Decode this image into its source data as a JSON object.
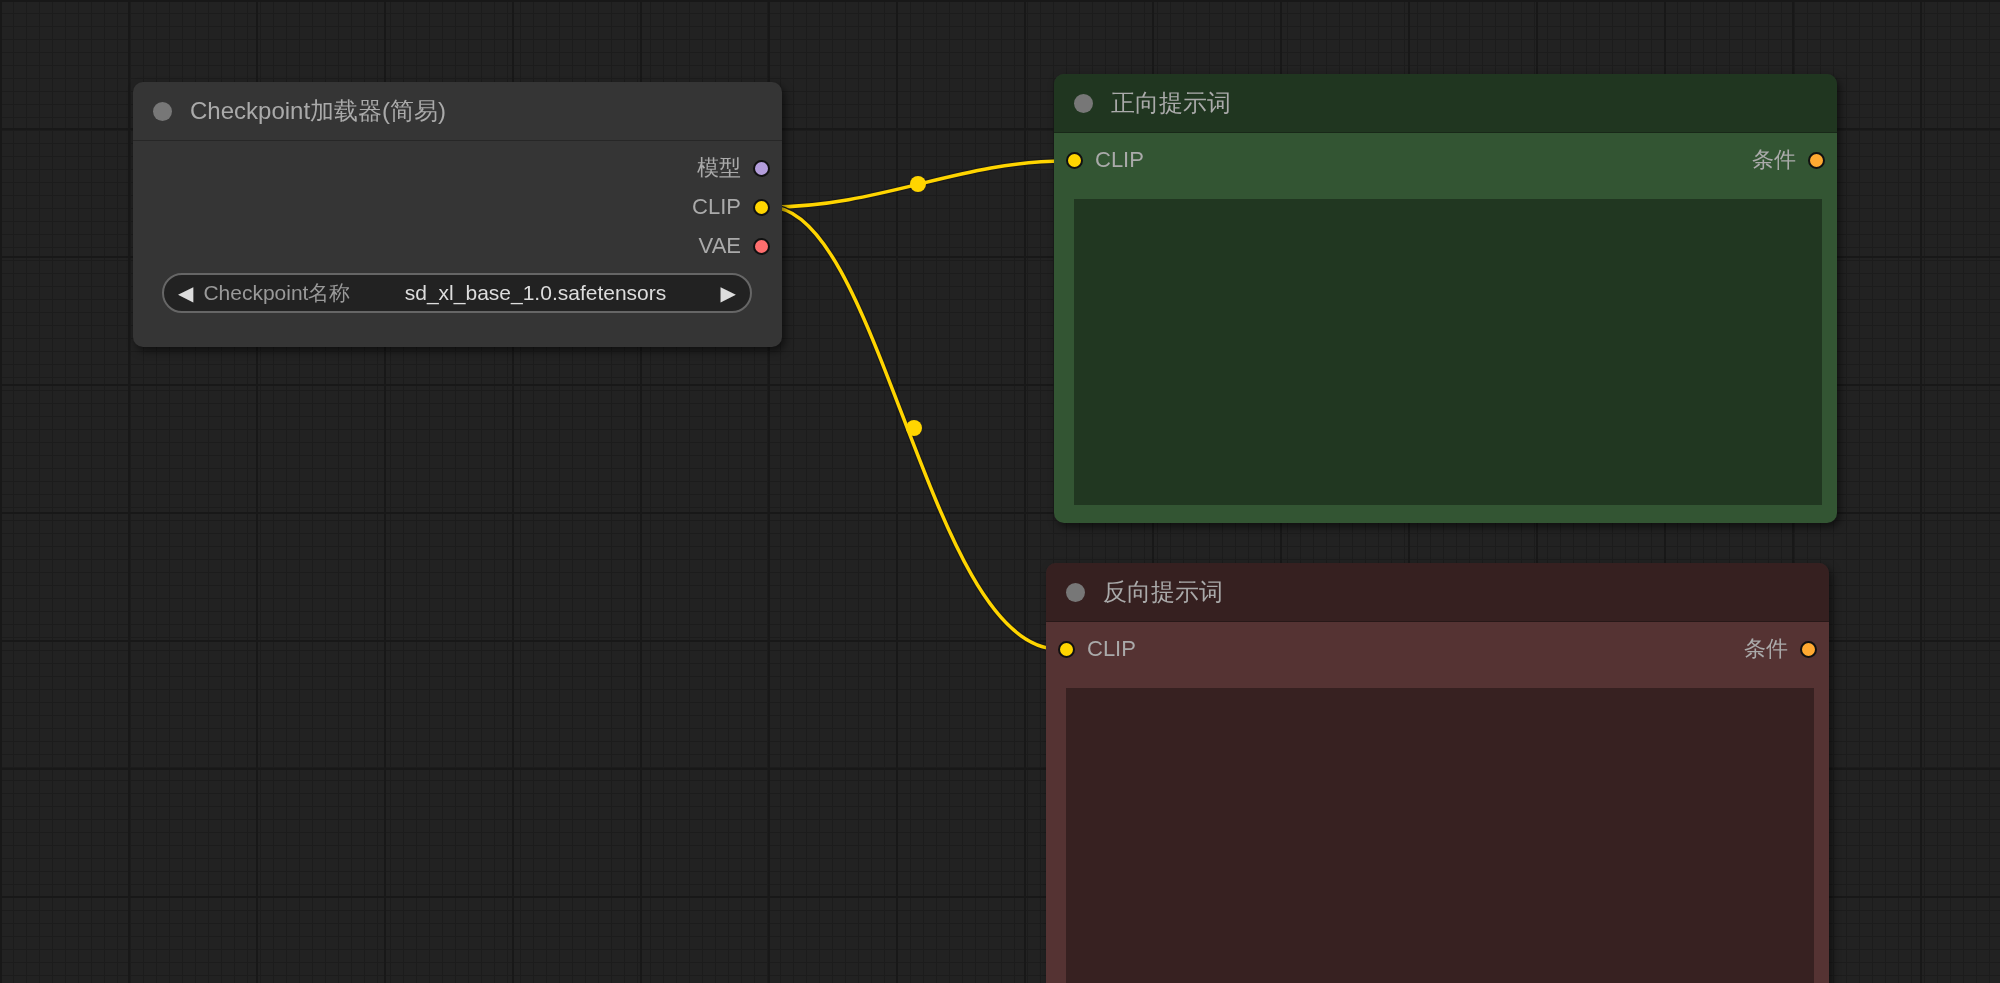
{
  "nodes": [
    {
      "kind": "loader",
      "title": "Checkpoint加载器(简易)",
      "color": "#353535",
      "outputs": [
        {
          "label": "模型",
          "color": "#b39ddb"
        },
        {
          "label": "CLIP",
          "color": "#ffd500"
        },
        {
          "label": "VAE",
          "color": "#ff6e6e"
        }
      ],
      "widget": {
        "left_arrow": "◀",
        "label": "Checkpoint名称",
        "value": "sd_xl_base_1.0.safetensors",
        "right_arrow": "▶"
      }
    },
    {
      "kind": "prompt",
      "title": "正向提示词",
      "color": "#335533",
      "inputs": [
        {
          "label": "CLIP",
          "color": "#ffd500"
        }
      ],
      "outputs": [
        {
          "label": "条件",
          "color": "#ffa931"
        }
      ]
    },
    {
      "kind": "prompt",
      "title": "反向提示词",
      "color": "#553333",
      "inputs": [
        {
          "label": "CLIP",
          "color": "#ffd500"
        }
      ],
      "outputs": [
        {
          "label": "条件",
          "color": "#ffa931"
        }
      ]
    }
  ]
}
